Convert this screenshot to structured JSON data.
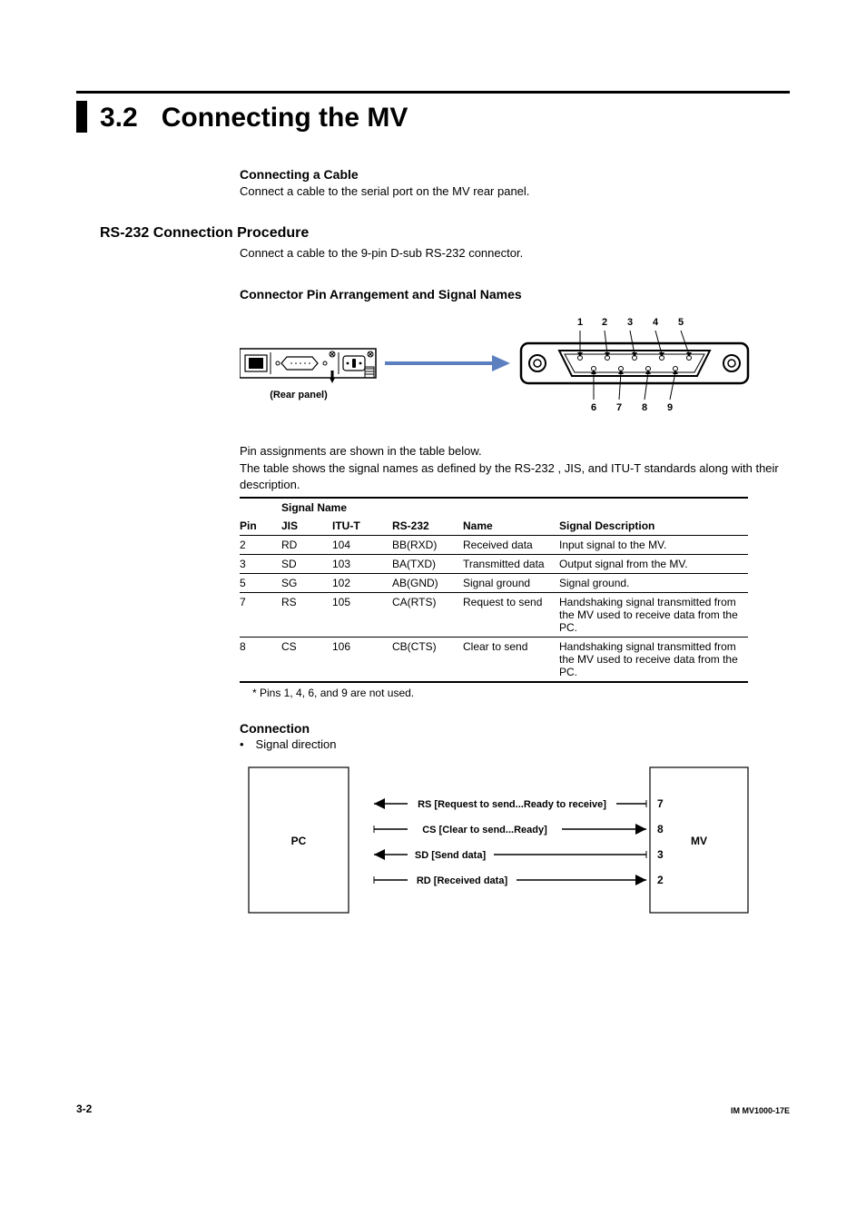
{
  "section": {
    "number": "3.2",
    "title": "Connecting the MV"
  },
  "cable": {
    "heading": "Connecting a Cable",
    "text": "Connect a cable to the serial port on the MV rear panel."
  },
  "rs232": {
    "heading": "RS-232 Connection Procedure",
    "text": "Connect a cable to the 9-pin D-sub RS-232 connector."
  },
  "connector": {
    "heading": "Connector Pin Arrangement and Signal Names",
    "rear_panel_caption": "(Rear panel)",
    "pins_top": [
      "1",
      "2",
      "3",
      "4",
      "5"
    ],
    "pins_bottom": [
      "6",
      "7",
      "8",
      "9"
    ]
  },
  "table_intro": {
    "line1": "Pin assignments are shown in the table below.",
    "line2": "The table shows the signal names as defined by the RS-232 , JIS, and ITU-T standards along with their description."
  },
  "table": {
    "headers": {
      "pin": "Pin",
      "signal_name": "Signal Name",
      "jis": "JIS",
      "itut": "ITU-T",
      "rs232": "RS-232",
      "name": "Name",
      "desc": "Signal Description"
    },
    "rows": [
      {
        "pin": "2",
        "jis": "RD",
        "itut": "104",
        "rs232": "BB(RXD)",
        "name": "Received data",
        "desc": "Input signal to the MV."
      },
      {
        "pin": "3",
        "jis": "SD",
        "itut": "103",
        "rs232": "BA(TXD)",
        "name": "Transmitted data",
        "desc": "Output signal from the MV."
      },
      {
        "pin": "5",
        "jis": "SG",
        "itut": "102",
        "rs232": "AB(GND)",
        "name": "Signal ground",
        "desc": "Signal ground."
      },
      {
        "pin": "7",
        "jis": "RS",
        "itut": "105",
        "rs232": "CA(RTS)",
        "name": "Request to send",
        "desc": "Handshaking signal transmitted from the MV used to receive data from the PC."
      },
      {
        "pin": "8",
        "jis": "CS",
        "itut": "106",
        "rs232": "CB(CTS)",
        "name": "Clear to send",
        "desc": "Handshaking signal transmitted from the MV used to receive data from the PC."
      }
    ],
    "note": "* Pins 1, 4, 6, and 9 are not used."
  },
  "connection": {
    "heading": "Connection",
    "bullet": "• Signal direction"
  },
  "signal_diagram": {
    "pc": "PC",
    "mv": "MV",
    "lines": [
      {
        "label": "RS [Request to send...Ready to receive]",
        "pin": "7",
        "from": "right",
        "arrow": "left"
      },
      {
        "label": "CS [Clear to send...Ready]",
        "pin": "8",
        "from": "left",
        "arrow": "right"
      },
      {
        "label": "SD [Send data]",
        "pin": "3",
        "from": "right",
        "arrow": "left"
      },
      {
        "label": "RD [Received data]",
        "pin": "2",
        "from": "left",
        "arrow": "right"
      }
    ]
  },
  "footer": {
    "page": "3-2",
    "doc": "IM MV1000-17E"
  }
}
